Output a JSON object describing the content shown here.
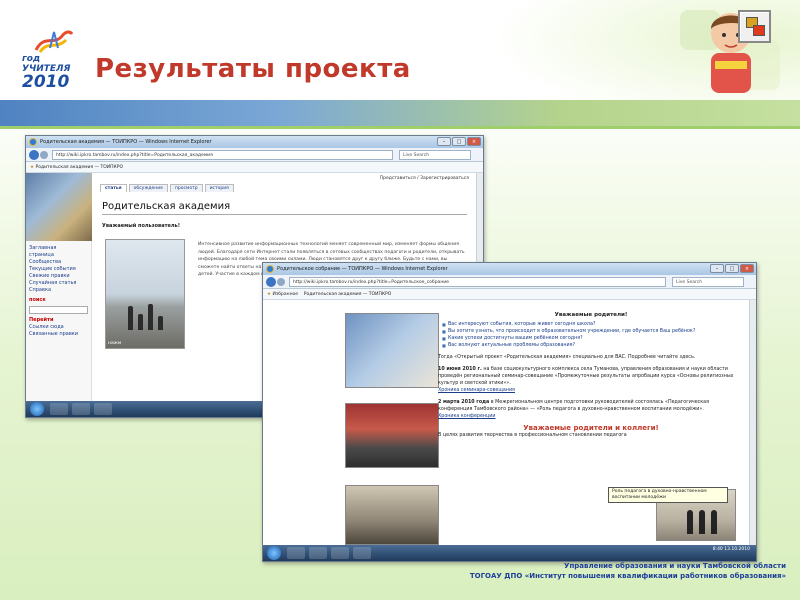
{
  "slide": {
    "title": "Результаты проекта",
    "logo": {
      "line1": "год",
      "line2": "УЧИТЕЛЯ",
      "line3": "2010"
    },
    "footer": {
      "line1": "Управление образования и науки Тамбовской области",
      "line2": "ТОГОАУ ДПО «Институт повышения квалификации работников образования»"
    },
    "colors": {
      "title": "#c0392b",
      "footer": "#1d3f9a",
      "band": "#4f83c1"
    }
  },
  "win1": {
    "title": "Родительская академия — ТОИПКРО — Windows Internet Explorer",
    "url": "http://wiki.ipkro.tambov.ru/index.php?title=Родительская_академия",
    "search_placeholder": "Live Search",
    "favorites": "Родительская академия — ТОИПКРО",
    "top_link": "Представиться / Зарегистрироваться",
    "tabs": [
      "статья",
      "обсуждение",
      "просмотр",
      "история"
    ],
    "heading": "Родительская академия",
    "subheading": "Уважаемый пользователь!",
    "photo_caption": "нажм",
    "text": "Интенсивное развитие информационных технологий меняет современный мир, изменяет формы общения людей. Благодаря сети Интернет стали появляться в сетевых сообществах педагоги и родители, открывать информацию на любой тема своими силами. Люди становятся друг к другу ближе. Будьте с нами, вы сможете найти ответы на вопросы, рассказать о своих решениях, обсудить проблемы воспитания и обучения детей. Участие в каждом из сообществ...",
    "menu_groups": [
      {
        "title": "",
        "items": [
          "Заглавная",
          "страница",
          "Сообщества",
          "Текущие события",
          "Свежие правки",
          "Случайная статья",
          "Справка"
        ]
      },
      {
        "title": "поиск",
        "items": []
      },
      {
        "title": "Перейти",
        "items": [
          "Ссылки сюда",
          "Связанные правки"
        ]
      }
    ]
  },
  "win2": {
    "title": "Родительское собрание — ТОИПКРО — Windows Internet Explorer",
    "url": "http://wiki.ipkro.tambov.ru/index.php?title=Родительское_собрание",
    "search_placeholder": "Live Search",
    "favorites": "Избранное",
    "tab_label": "Родительская академия — ТОИПКРО",
    "greeting": "Уважаемые родители!",
    "bullets": [
      "Вас интересуют события, которые живет сегодня школа?",
      "Вы хотите узнать, что происходит в образовательном учреждении, где обучается Ваш ребёнок?",
      "Какие успехи достигнуты вашим ребёнком сегодня?",
      "Вас волнуют актуальные проблемы образования?"
    ],
    "intro": "Тогда «Открытый проект «Родительская академия» специально для ВАС. Подробнее читайте здесь.",
    "news1_date": "10 июня 2010 г.",
    "news1": "на базе социокультурного комплекса села Туманова, управления образования и науки области проведён региональный семинар-совещание «Промежуточные результаты апробации курса «Основы религиозных культур и светской этики»».",
    "news1_link": "Хроника семинара-совещания",
    "news2_date": "2 марта 2010 года",
    "news2": "в Межрегиональном центре подготовки руководителей состоялась «Педагогическая конференция Тамбовского района» — «Роль педагога в духовно-нравственном воспитании молодёжи».",
    "news2_link": "Хроника конференции",
    "tooltip": "Роль педагога в духовно-нравственном воспитании молодёжи",
    "footer_heading": "Уважаемые родители и коллеги!",
    "footer_text": "В целях развития творчества в профессиональном становлении педагога",
    "clock": "8:40 13.10.2010"
  }
}
